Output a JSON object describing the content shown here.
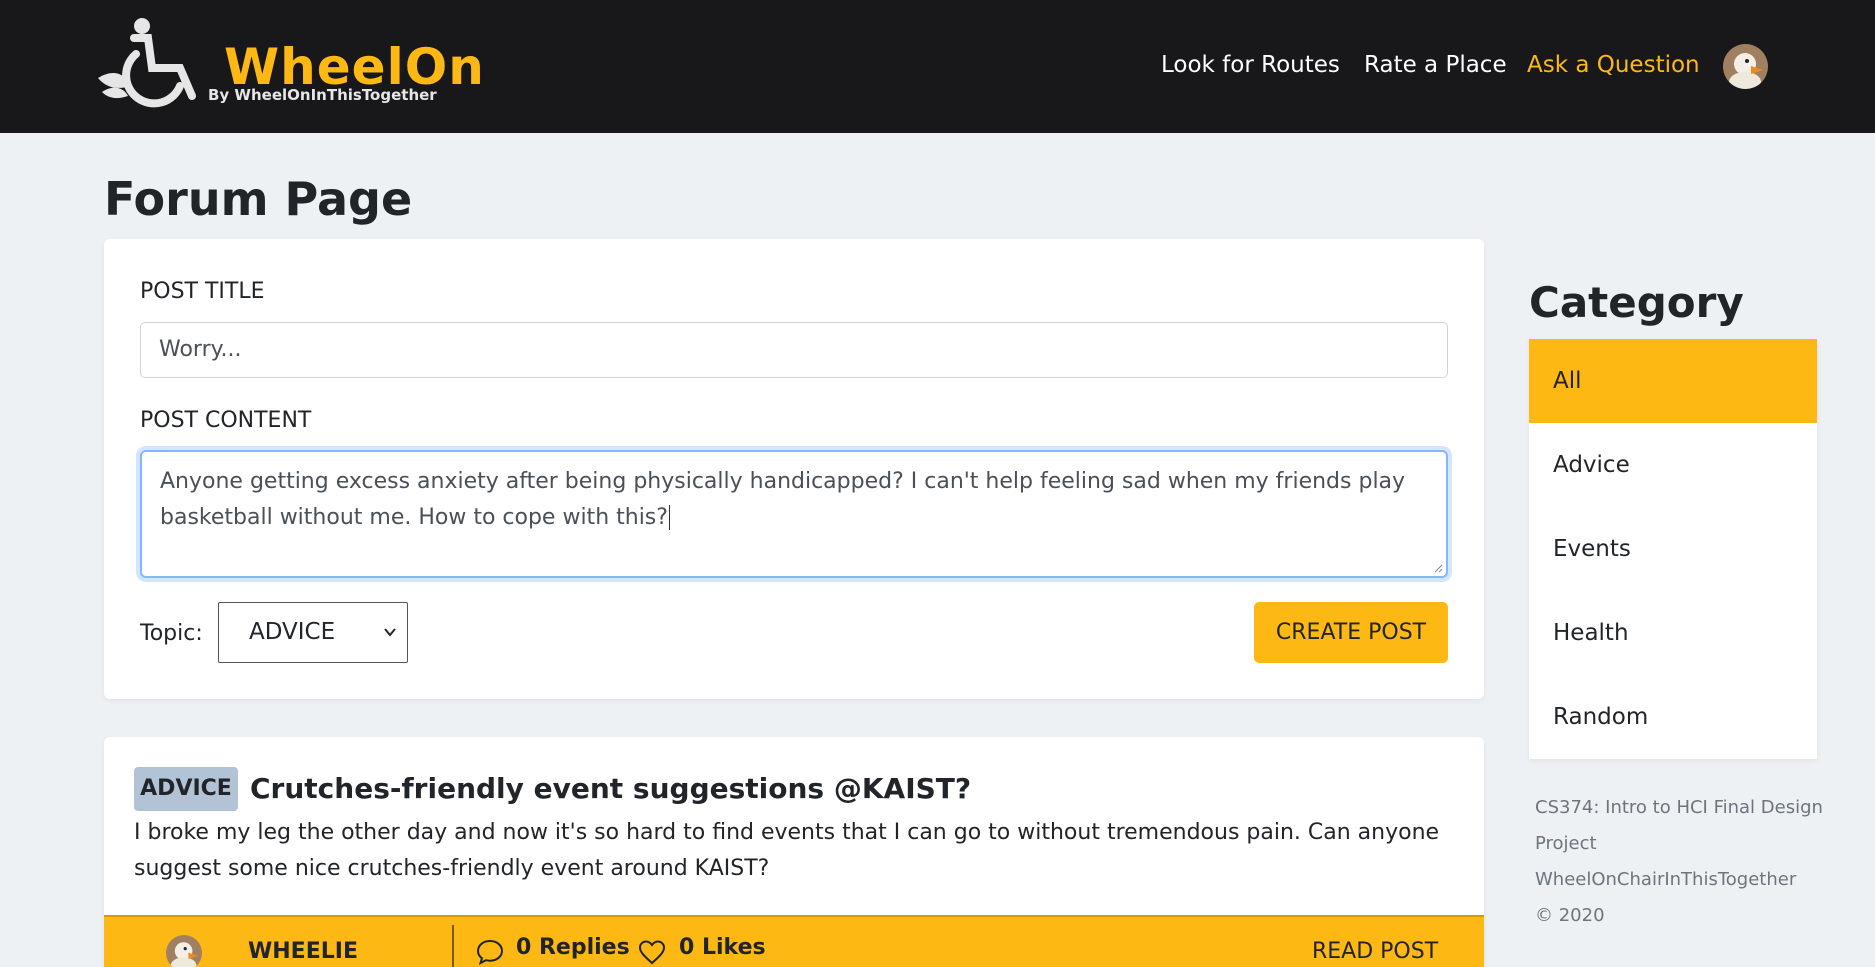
{
  "brand": {
    "name": "WheelOn",
    "tagline": "By WheelOnInThisTogether"
  },
  "nav": {
    "links": [
      {
        "label": "Look for Routes"
      },
      {
        "label": "Rate a Place"
      },
      {
        "label": "Ask a Question",
        "active": true
      }
    ],
    "avatar_icon": "duck-avatar-icon"
  },
  "page": {
    "title": "Forum Page"
  },
  "form": {
    "title_label": "POST TITLE",
    "title_value": "Worry...",
    "content_label": "POST CONTENT",
    "content_value": "Anyone getting excess anxiety after being physically handicapped? I can't help feeling sad when my friends play basketball without me. How to cope with this?",
    "topic_label": "Topic:",
    "topic_selected": "ADVICE",
    "create_label": "CREATE POST"
  },
  "posts": [
    {
      "tag": "ADVICE",
      "title": "Crutches-friendly event suggestions @KAIST?",
      "body": "I broke my leg the other day and now it's so hard to find events that I can go to without tremendous pain. Can anyone suggest some nice crutches-friendly event around KAIST?",
      "author": "WHEELIE",
      "replies": "0 Replies",
      "likes": "0 Likes",
      "read_label": "READ POST"
    }
  ],
  "sidebar": {
    "title": "Category",
    "categories": [
      {
        "label": "All",
        "active": true
      },
      {
        "label": "Advice"
      },
      {
        "label": "Events"
      },
      {
        "label": "Health"
      },
      {
        "label": "Random"
      }
    ]
  },
  "credits": {
    "line1": "CS374: Intro to HCI Final Design Project",
    "line2": "WheelOnChairInThisTogether",
    "line3": "© 2020"
  },
  "colors": {
    "accent": "#fdb813",
    "navbar": "#18181a",
    "background": "#eef1f4",
    "badge": "#b3c3d6"
  }
}
